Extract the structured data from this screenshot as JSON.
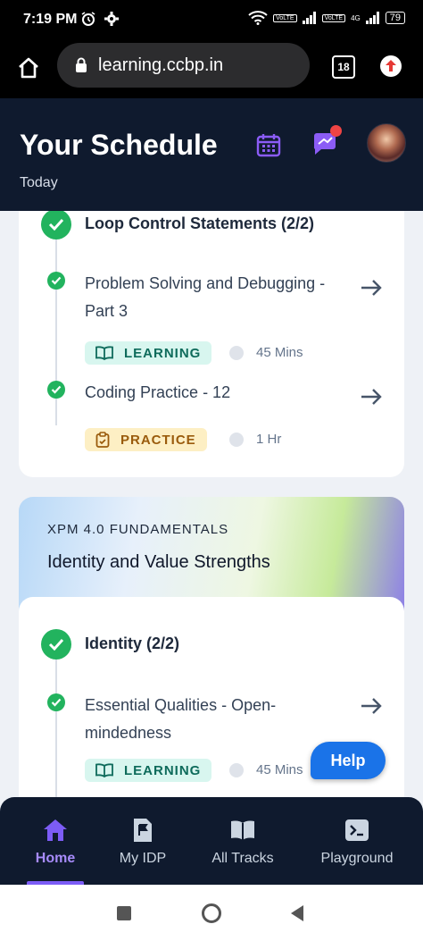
{
  "status_bar": {
    "time": "7:19 PM",
    "network_1": "VoLTE",
    "network_2": "VoLTE",
    "network_3": "4G",
    "battery": "79"
  },
  "browser": {
    "url": "learning.ccbp.in",
    "tab_count": "18"
  },
  "header": {
    "title": "Your Schedule",
    "subtitle": "Today"
  },
  "schedule": {
    "module_1": {
      "title": "Loop Control Statements (2/2)",
      "items": [
        {
          "title": "Problem Solving and Debugging - Part 3",
          "tag": "LEARNING",
          "duration": "45 Mins"
        },
        {
          "title": "Coding Practice - 12",
          "tag": "PRACTICE",
          "duration": "1 Hr"
        }
      ]
    },
    "course_2": {
      "category": "XPM 4.0 FUNDAMENTALS",
      "name": "Identity and Value Strengths",
      "module": {
        "title": "Identity (2/2)",
        "items": [
          {
            "title": "Essential Qualities - Open-mindedness",
            "tag": "LEARNING",
            "duration": "45 Mins"
          }
        ]
      }
    }
  },
  "help_label": "Help",
  "bottom_nav": {
    "items": [
      {
        "label": "Home",
        "icon": "home-icon",
        "active": true
      },
      {
        "label": "My IDP",
        "icon": "flag-doc-icon",
        "active": false
      },
      {
        "label": "All Tracks",
        "icon": "book-icon",
        "active": false
      },
      {
        "label": "Playground",
        "icon": "terminal-icon",
        "active": false
      }
    ]
  },
  "colors": {
    "header_bg": "#0f1a2e",
    "accent": "#7c5cf6",
    "success": "#22b35e",
    "help_button": "#1a73e8"
  }
}
